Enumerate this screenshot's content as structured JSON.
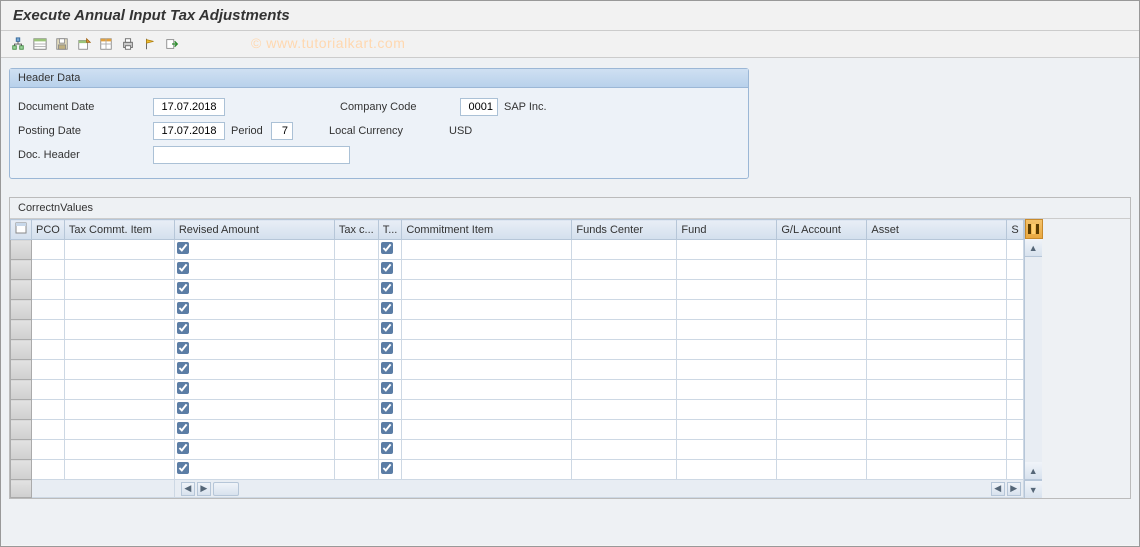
{
  "title": "Execute Annual Input Tax Adjustments",
  "watermark": "© www.tutorialkart.com",
  "header": {
    "panel_title": "Header Data",
    "document_date_label": "Document Date",
    "document_date_value": "17.07.2018",
    "posting_date_label": "Posting Date",
    "posting_date_value": "17.07.2018",
    "period_label": "Period",
    "period_value": "7",
    "company_code_label": "Company Code",
    "company_code_value": "0001",
    "company_name": "SAP Inc.",
    "local_currency_label": "Local Currency",
    "local_currency_value": "USD",
    "doc_header_label": "Doc. Header",
    "doc_header_value": ""
  },
  "table": {
    "title": "CorrectnValues",
    "columns": {
      "pco": "PCO",
      "tax_commt_item": "Tax Commt. Item",
      "revised_amount": "Revised Amount",
      "tax_c": "Tax c...",
      "t": "T...",
      "commitment_item": "Commitment Item",
      "funds_center": "Funds Center",
      "fund": "Fund",
      "gl_account": "G/L Account",
      "asset": "Asset",
      "s": "S"
    },
    "rows": [
      {
        "revised_checked": true,
        "t_checked": true
      },
      {
        "revised_checked": true,
        "t_checked": true
      },
      {
        "revised_checked": true,
        "t_checked": true
      },
      {
        "revised_checked": true,
        "t_checked": true
      },
      {
        "revised_checked": true,
        "t_checked": true
      },
      {
        "revised_checked": true,
        "t_checked": true
      },
      {
        "revised_checked": true,
        "t_checked": true
      },
      {
        "revised_checked": true,
        "t_checked": true
      },
      {
        "revised_checked": true,
        "t_checked": true
      },
      {
        "revised_checked": true,
        "t_checked": true
      },
      {
        "revised_checked": true,
        "t_checked": true
      },
      {
        "revised_checked": true,
        "t_checked": true
      }
    ]
  }
}
